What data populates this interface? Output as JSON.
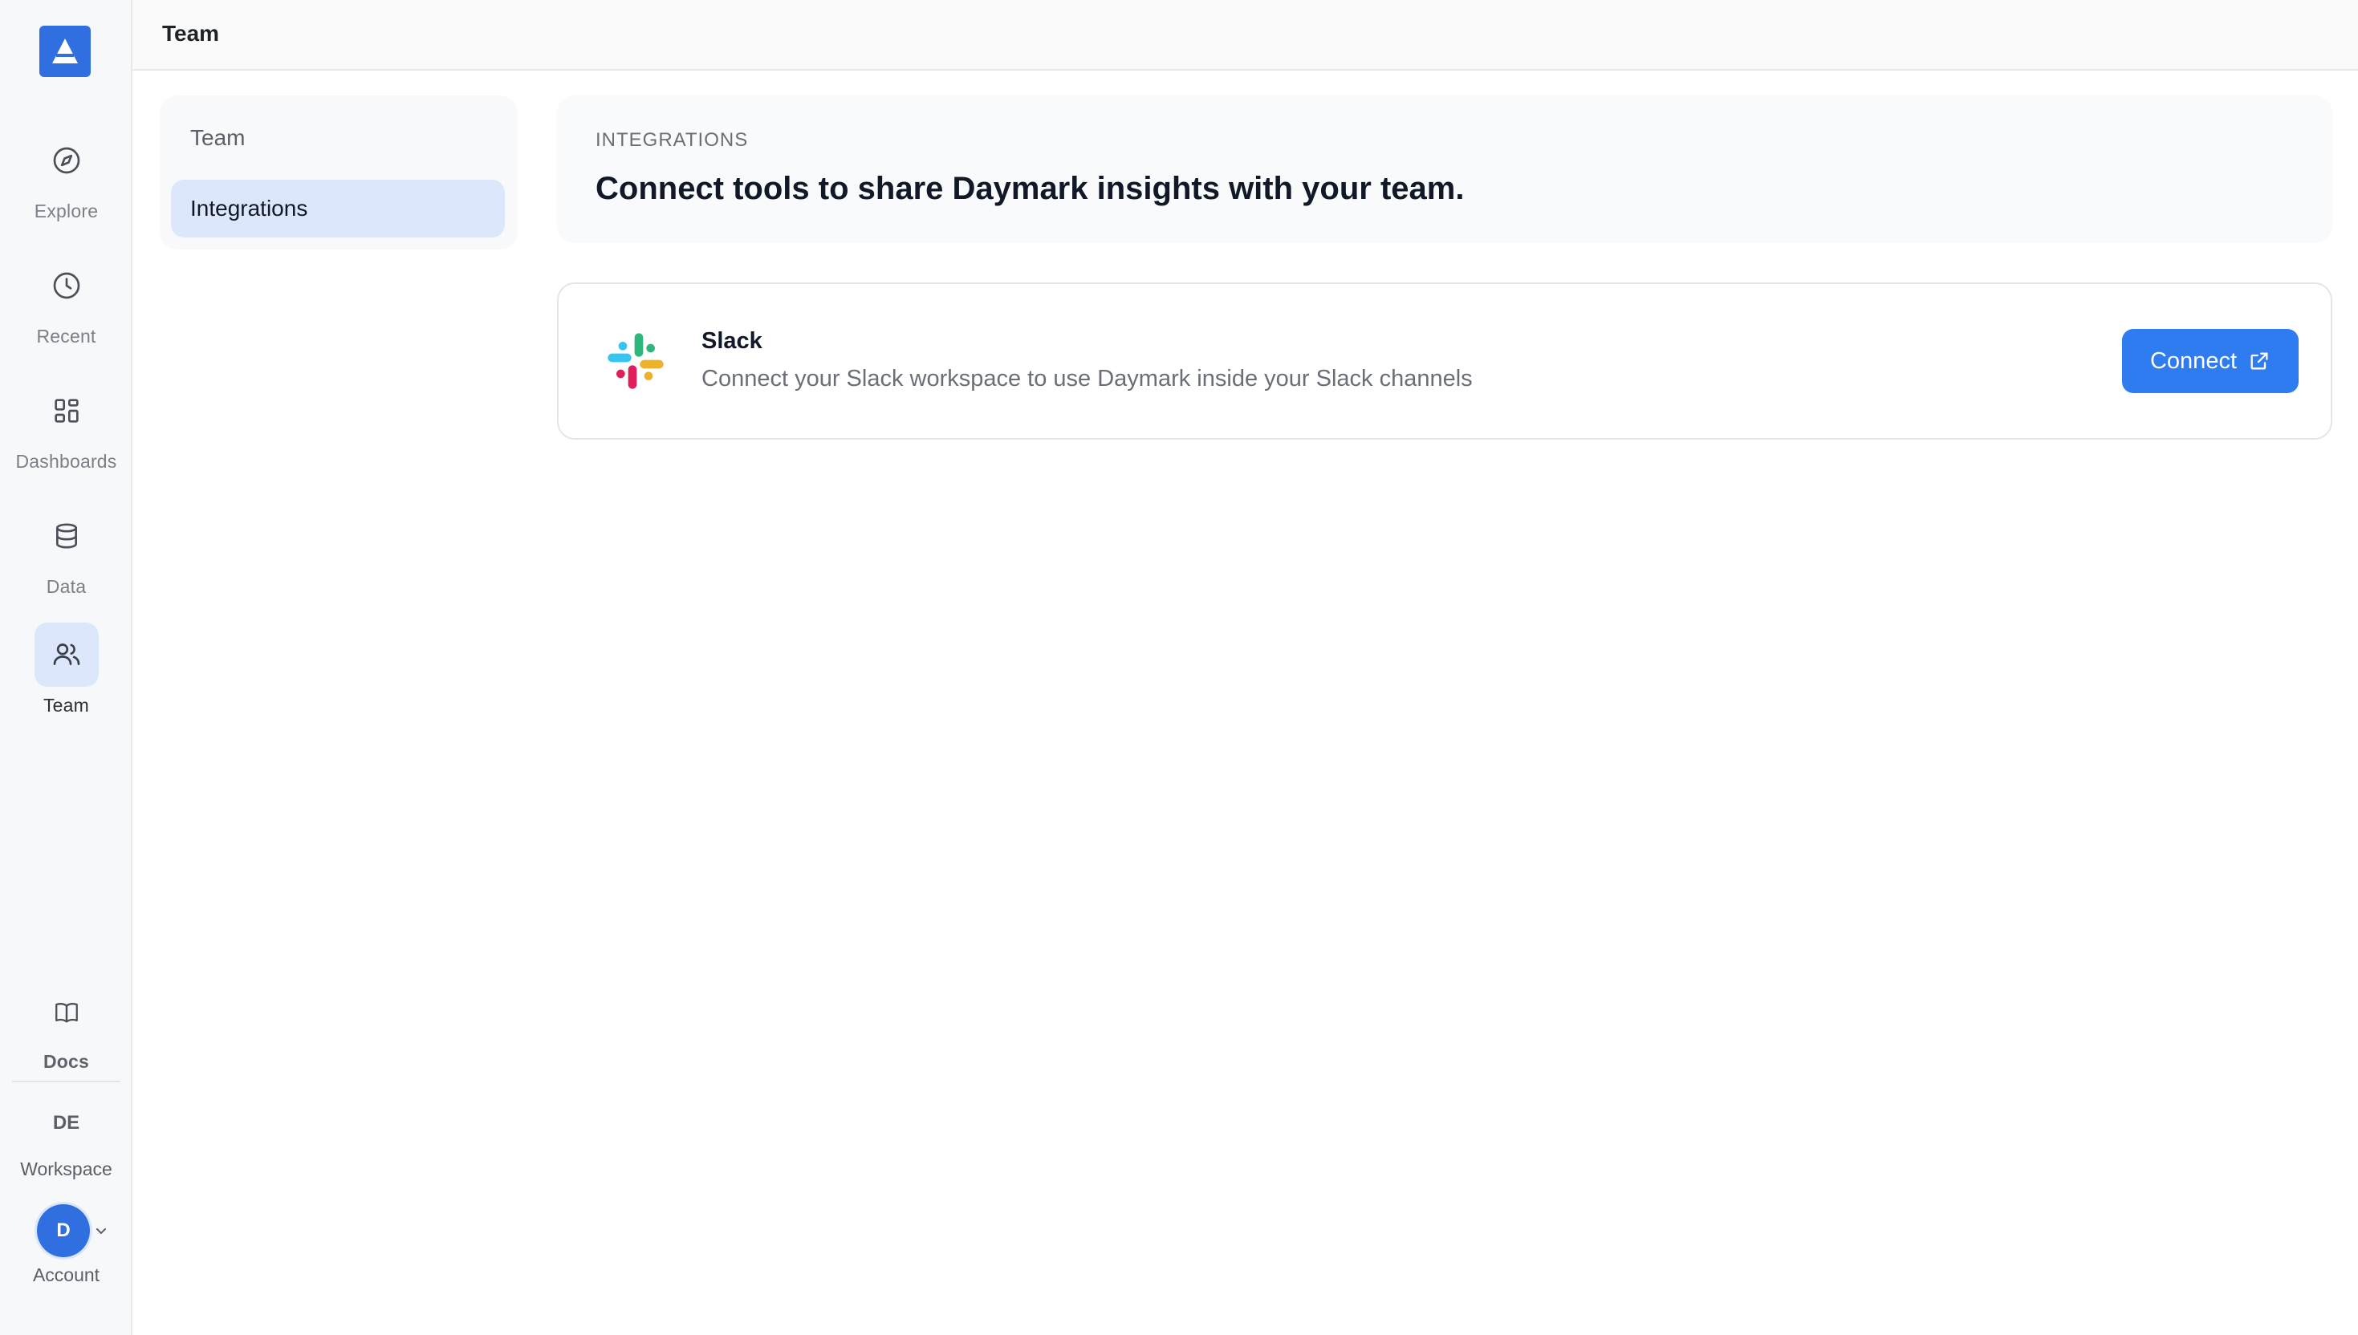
{
  "rail": {
    "items": [
      {
        "label": "Explore",
        "icon": "compass-icon"
      },
      {
        "label": "Recent",
        "icon": "clock-icon"
      },
      {
        "label": "Dashboards",
        "icon": "dashboard-grid-icon"
      },
      {
        "label": "Data",
        "icon": "database-icon"
      },
      {
        "label": "Team",
        "icon": "users-icon",
        "active": true
      }
    ],
    "docs_label": "Docs",
    "workspace_initials": "DE",
    "workspace_label": "Workspace",
    "avatar_initial": "D",
    "account_label": "Account"
  },
  "topbar": {
    "title": "Team"
  },
  "subnav": {
    "items": [
      {
        "label": "Team"
      },
      {
        "label": "Integrations",
        "active": true
      }
    ]
  },
  "header": {
    "eyebrow": "INTEGRATIONS",
    "title": "Connect tools to share Daymark insights with your team."
  },
  "integrations": [
    {
      "name": "Slack",
      "description": "Connect your Slack workspace to use Daymark inside your Slack channels",
      "button_label": "Connect",
      "icon": "slack-logo"
    }
  ],
  "colors": {
    "accent": "#2f6fe0",
    "button": "#2f7bf0",
    "active_bg": "#dde7fb"
  }
}
